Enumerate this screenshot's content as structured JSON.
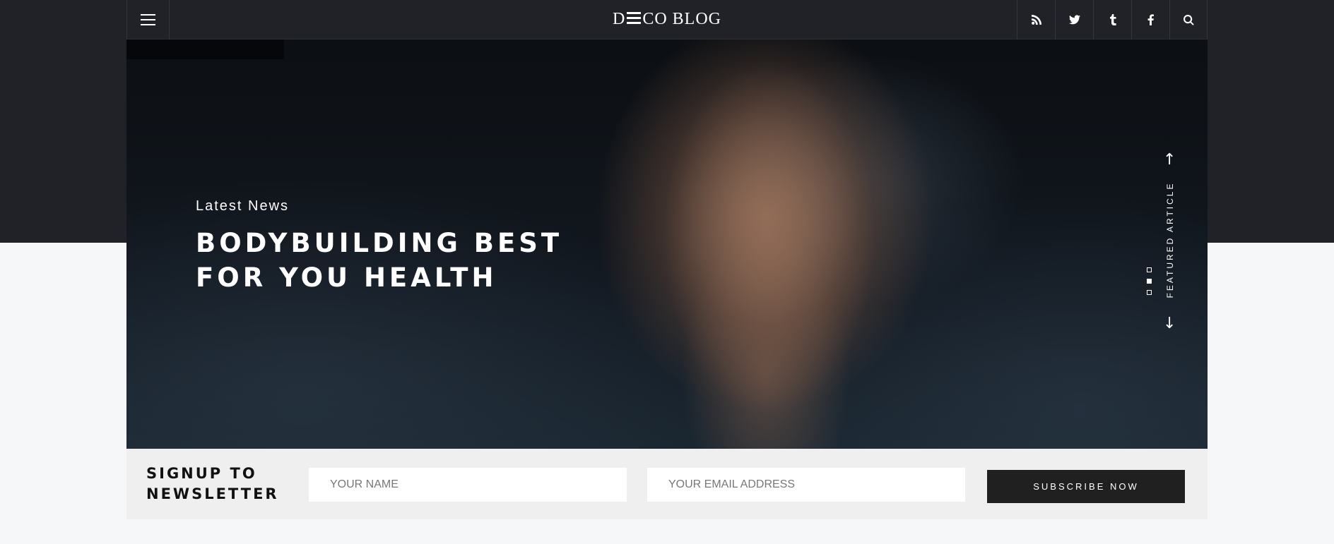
{
  "header": {
    "logo_left": "D",
    "logo_right": "CO BLOG",
    "menu_icon": "hamburger-icon",
    "social": [
      {
        "icon": "rss-icon"
      },
      {
        "icon": "twitter-icon"
      },
      {
        "icon": "tumblr-icon"
      },
      {
        "icon": "facebook-icon"
      },
      {
        "icon": "search-icon"
      }
    ]
  },
  "hero": {
    "kicker": "Latest News",
    "headline_line1": "BODYBUILDING BEST",
    "headline_line2": "FOR YOU HEALTH",
    "featured_label": "FEATURED ARTICLE",
    "slider_dots": 3,
    "active_dot": 2
  },
  "newsletter": {
    "title_line1": "SIGNUP TO",
    "title_line2": "NEWSLETTER",
    "name_placeholder": "YOUR NAME",
    "email_placeholder": "YOUR EMAIL ADDRESS",
    "button_label": "SUBSCRIBE NOW"
  },
  "colors": {
    "header_bg": "#202227",
    "page_bg": "#f6f7f8",
    "newsletter_bg": "#efefef",
    "button_bg": "#202020"
  }
}
